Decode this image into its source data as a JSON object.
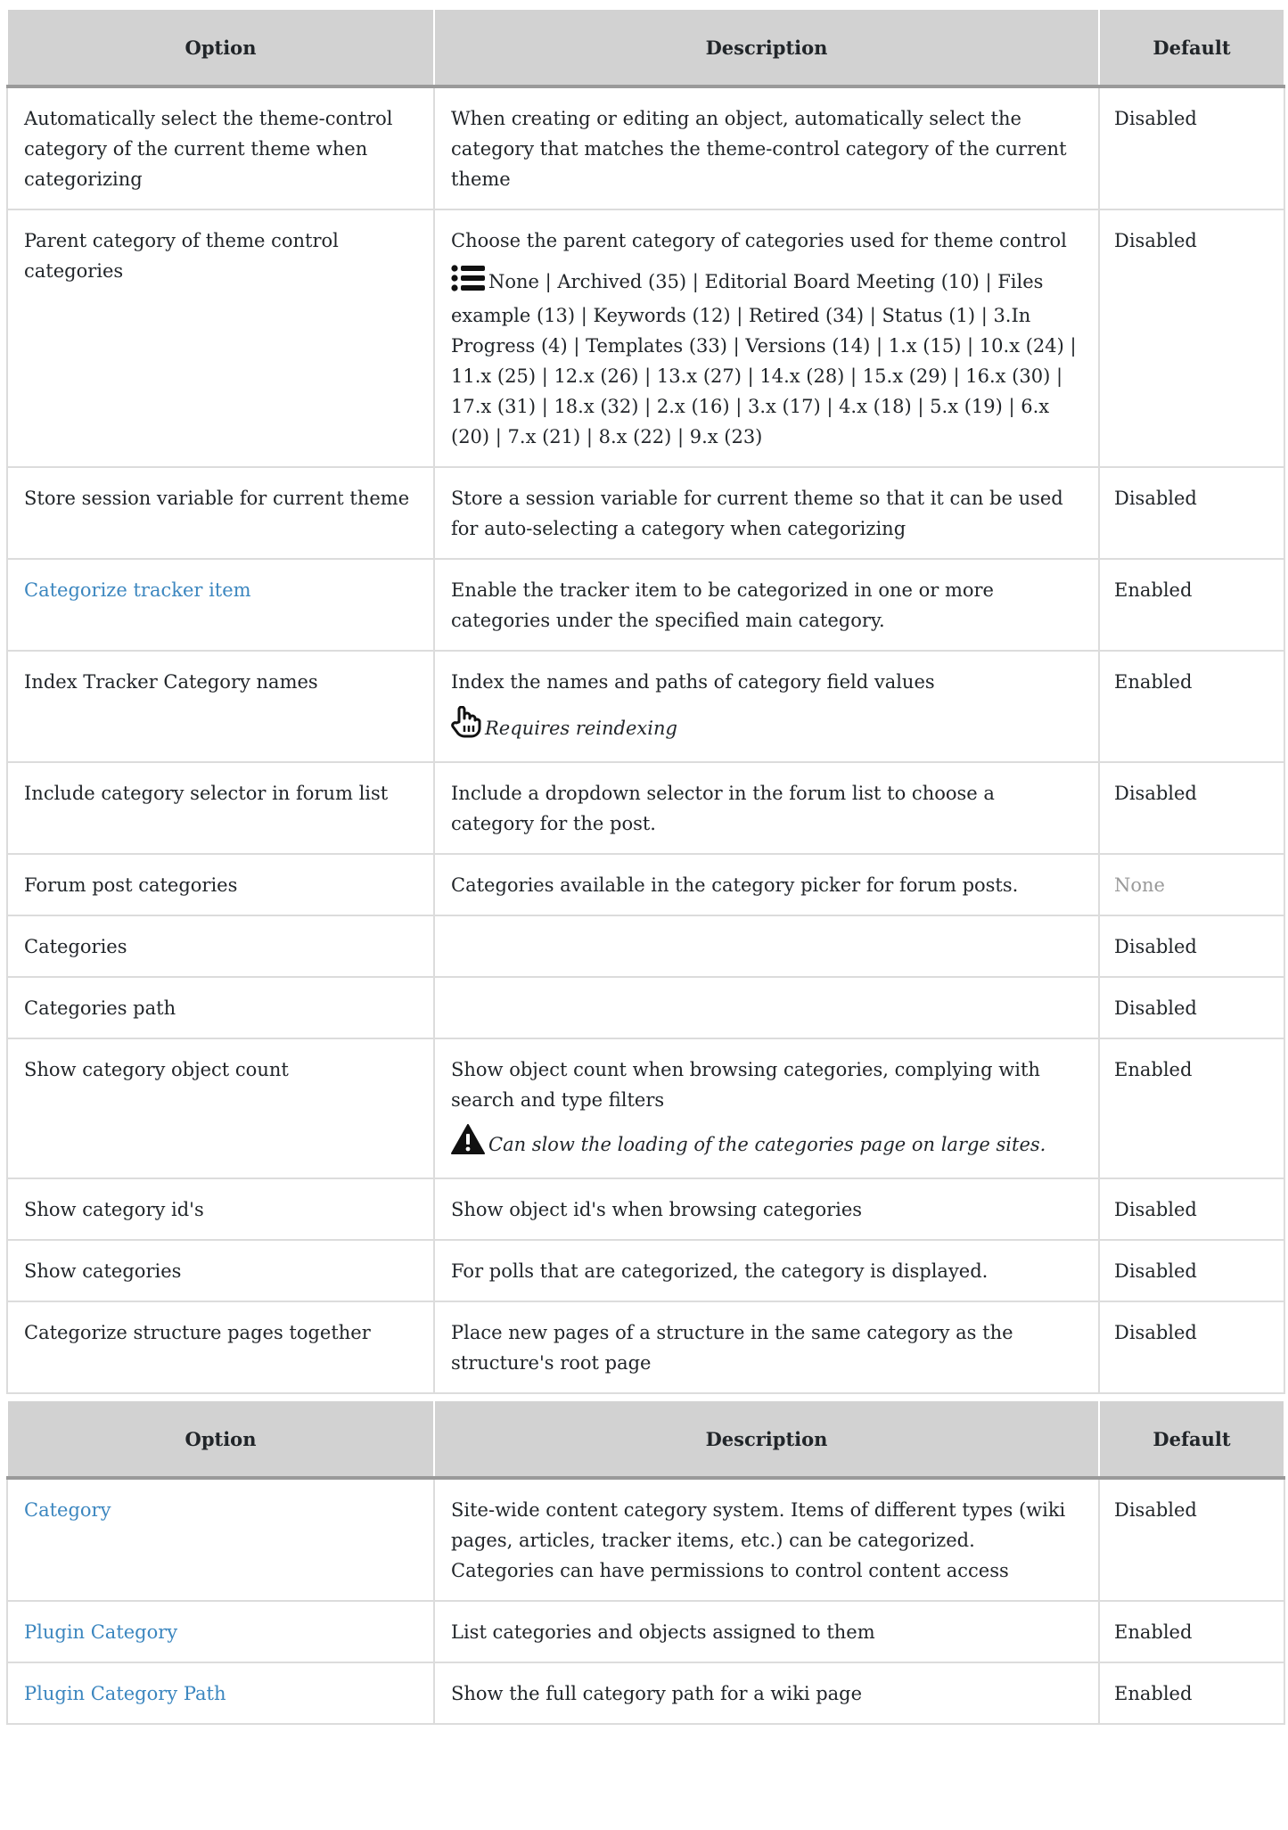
{
  "table1": {
    "headers": [
      "Option",
      "Description",
      "Default"
    ],
    "rows": [
      {
        "option": "Automatically select the theme-control category of the current theme when categorizing",
        "description": "When creating or editing an object, automatically select the category that matches the theme-control category of the current theme",
        "default": "Disabled"
      },
      {
        "option": "Parent category of theme control categories",
        "description": "Choose the parent category of categories used for theme control",
        "list_icon": "list-icon",
        "list_text": "None | Archived (35) | Editorial Board Meeting (10) | Files example (13) | Keywords (12) | Retired (34) | Status (1) | 3.In Progress (4) | Templates (33) | Versions (14) | 1.x (15) | 10.x (24) | 11.x (25) | 12.x (26) | 13.x (27) | 14.x (28) | 15.x (29) | 16.x (30) | 17.x (31) | 18.x (32) | 2.x (16) | 3.x (17) | 4.x (18) | 5.x (19) | 6.x (20) | 7.x (21) | 8.x (22) | 9.x (23)",
        "default": "Disabled"
      },
      {
        "option": "Store session variable for current theme",
        "description": "Store a session variable for current theme so that it can be used for auto-selecting a category when categorizing",
        "default": "Disabled"
      },
      {
        "option": "Categorize tracker item",
        "description": "Enable the tracker item to be categorized in one or more categories under the specified main category.",
        "default": "Enabled"
      },
      {
        "option": "Index Tracker Category names",
        "description": "Index the names and paths of category field values",
        "note_icon": "hand-pointer-icon",
        "note": "Requires reindexing",
        "default": "Enabled"
      },
      {
        "option": "Include category selector in forum list",
        "description": "Include a dropdown selector in the forum list to choose a category for the post.",
        "default": "Disabled"
      },
      {
        "option": "Forum post categories",
        "description": "Categories available in the category picker for forum posts.",
        "default": "None"
      },
      {
        "option": "Categories",
        "description": "",
        "default": "Disabled"
      },
      {
        "option": "Categories path",
        "description": "",
        "default": "Disabled"
      },
      {
        "option": "Show category object count",
        "description": "Show object count when browsing categories, complying with search and type filters",
        "note_icon": "warning-icon",
        "note": "Can slow the loading of the categories page on large sites.",
        "default": "Enabled"
      },
      {
        "option": "Show category id's",
        "description": "Show object id's when browsing categories",
        "default": "Disabled"
      },
      {
        "option": "Show categories",
        "description": "For polls that are categorized, the category is displayed.",
        "default": "Disabled"
      },
      {
        "option": "Categorize structure pages together",
        "description": "Place new pages of a structure in the same category as the structure's root page",
        "default": "Disabled"
      }
    ]
  },
  "table2": {
    "headers": [
      "Option",
      "Description",
      "Default"
    ],
    "rows": [
      {
        "option": "Category",
        "description": "Site-wide content category system. Items of different types (wiki pages, articles, tracker items, etc.) can be categorized. Categories can have permissions to control content access",
        "default": "Disabled"
      },
      {
        "option": "Plugin Category",
        "description": "List categories and objects assigned to them",
        "default": "Enabled"
      },
      {
        "option": "Plugin Category Path",
        "description": "Show the full category path for a wiki page",
        "default": "Enabled"
      }
    ]
  },
  "colors": {
    "link": "#3b86bf",
    "header_bg": "#d2d2d2",
    "muted": "#9a9a9a"
  }
}
